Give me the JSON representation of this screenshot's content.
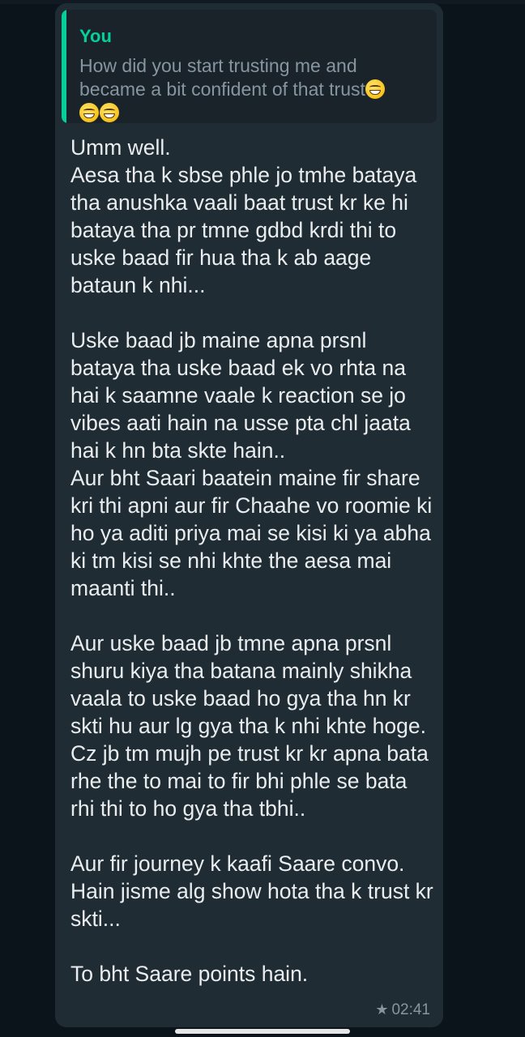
{
  "quoted": {
    "sender": "You",
    "text": "How did you start trusting me and became a bit confident of that trust"
  },
  "message": {
    "text": "Umm well.\nAesa tha k sbse phle jo tmhe bataya tha anushka vaali baat trust kr ke hi bataya tha pr tmne gdbd krdi thi to uske baad fir hua tha k ab aage bataun k nhi...\n\nUske baad jb maine apna prsnl bataya tha uske baad ek vo rhta na hai k saamne vaale k reaction se jo vibes aati hain na usse pta chl jaata hai k hn bta skte hain..\nAur bht Saari baatein maine fir share kri thi apni aur fir Chaahe vo roomie ki ho ya aditi priya mai se kisi ki ya abha ki tm kisi se nhi khte the aesa mai maanti thi..\n\nAur uske baad jb tmne apna prsnl shuru kiya tha batana mainly shikha vaala to uske baad ho gya tha hn kr skti hu aur lg gya tha k nhi khte hoge.\nCz jb tm mujh pe trust kr kr apna bata rhe the to mai to fir bhi phle se bata rhi thi to ho gya tha tbhi..\n\nAur fir journey k kaafi Saare convo. Hain jisme alg show hota tha k trust kr skti...\n\nTo bht Saare points hain.",
    "time": "02:41",
    "starred_icon": "star-icon"
  },
  "colors": {
    "background": "#0b141a",
    "bubble": "#202c33",
    "quote_accent": "#06cf9c",
    "text": "#e9edef",
    "muted": "#8696a0"
  }
}
